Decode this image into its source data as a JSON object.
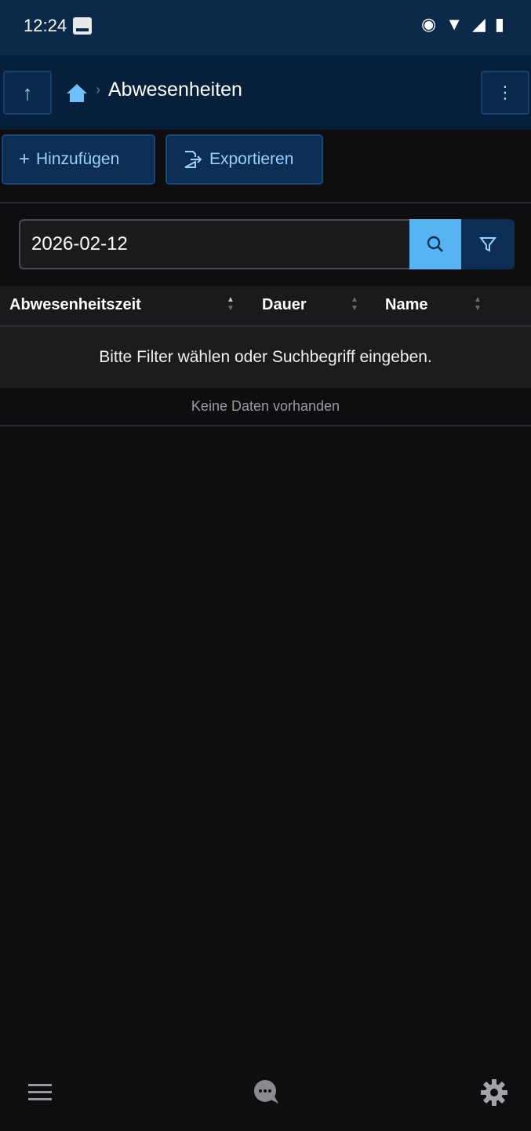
{
  "status_bar": {
    "time": "12:24",
    "icons": [
      "eye-icon",
      "wifi-icon",
      "signal-icon",
      "battery-icon"
    ]
  },
  "header": {
    "back_icon": "↑",
    "title": "Abwesenheiten",
    "more_icon": "⋮"
  },
  "toolbar": {
    "add_label": "Hinzufügen",
    "export_label": "Exportieren"
  },
  "search": {
    "value": "2026-02-12",
    "placeholder": ""
  },
  "table": {
    "columns": [
      "Abwesenheitszeit",
      "Dauer",
      "Name"
    ],
    "hint": "Bitte Filter wählen oder Suchbegriff eingeben.",
    "empty": "Keine Daten vorhanden"
  },
  "colors": {
    "status_bg": "#0b2a4a",
    "header_bg": "#06203b",
    "button_bg": "#0c2e55",
    "accent": "#56b4f5",
    "page_bg": "#0e0e10"
  },
  "bottom_nav": {
    "icons": [
      "menu-icon",
      "chat-icon",
      "gear-icon"
    ]
  }
}
